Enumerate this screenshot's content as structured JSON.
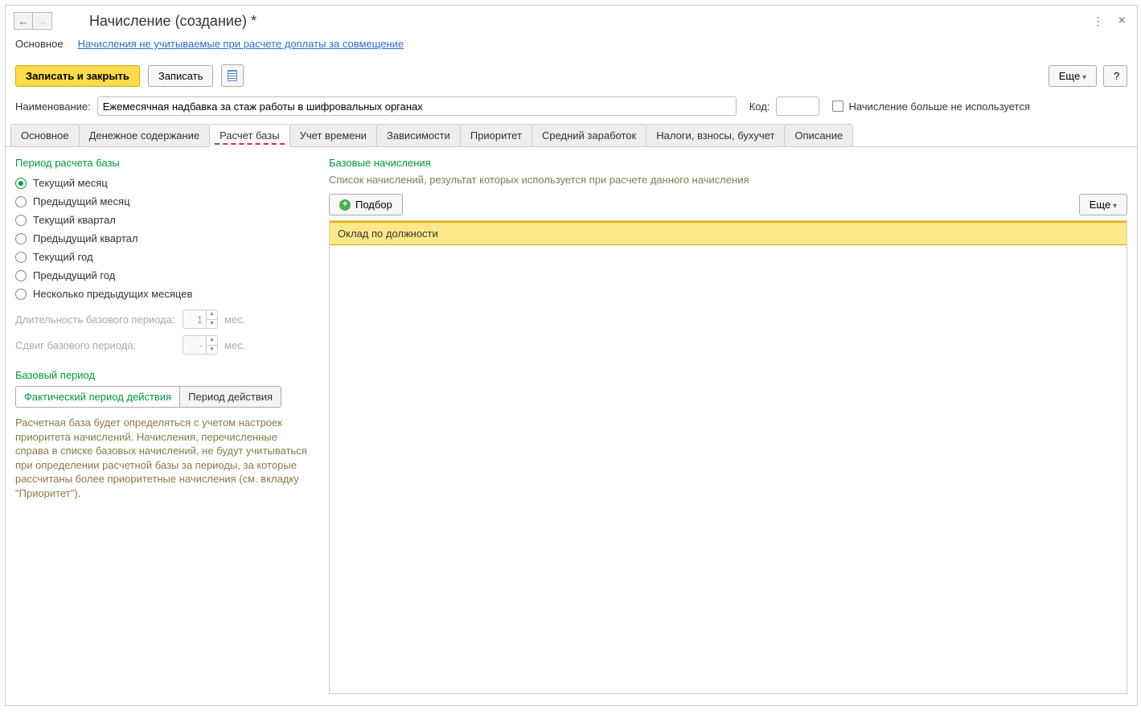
{
  "window": {
    "title": "Начисление (создание) *"
  },
  "nav": {
    "main": "Основное",
    "link": "Начисления не учитываемые при расчете доплаты за совмещение"
  },
  "toolbar": {
    "saveClose": "Записать и закрыть",
    "save": "Записать",
    "more": "Еще",
    "help": "?"
  },
  "form": {
    "nameLabel": "Наименование:",
    "nameValue": "Ежемесячная надбавка за стаж работы в шифровальных органах",
    "codeLabel": "Код:",
    "codeValue": "",
    "disabledLabel": "Начисление больше не используется"
  },
  "tabs": [
    "Основное",
    "Денежное содержание",
    "Расчет базы",
    "Учет времени",
    "Зависимости",
    "Приоритет",
    "Средний заработок",
    "Налоги, взносы, бухучет",
    "Описание"
  ],
  "activeTabIndex": 2,
  "left": {
    "periodTitle": "Период расчета базы",
    "radios": [
      "Текущий месяц",
      "Предыдущий месяц",
      "Текущий квартал",
      "Предыдущий квартал",
      "Текущий год",
      "Предыдущий год",
      "Несколько предыдущих месяцев"
    ],
    "selectedRadio": 0,
    "durationLabel": "Длительность базового периода:",
    "durationValue": "1",
    "durationUnit": "мес.",
    "shiftLabel": "Сдвиг базового периода:",
    "shiftValue": "-",
    "shiftUnit": "мес.",
    "basePeriodTitle": "Базовый период",
    "toggleActual": "Фактический период действия",
    "togglePeriod": "Период действия",
    "note": "Расчетная база будет определяться с учетом настроек приоритета начислений. Начисления, перечисленные справа в списке базовых начислений, не будут учитываться при определении расчетной базы за периоды, за которые рассчитаны более приоритетные начисления (см. вкладку \"Приоритет\")."
  },
  "right": {
    "title": "Базовые начисления",
    "desc": "Список начислений, результат которых используется при расчете данного начисления",
    "podbor": "Подбор",
    "more": "Еще",
    "rows": [
      "Оклад по должности"
    ]
  }
}
